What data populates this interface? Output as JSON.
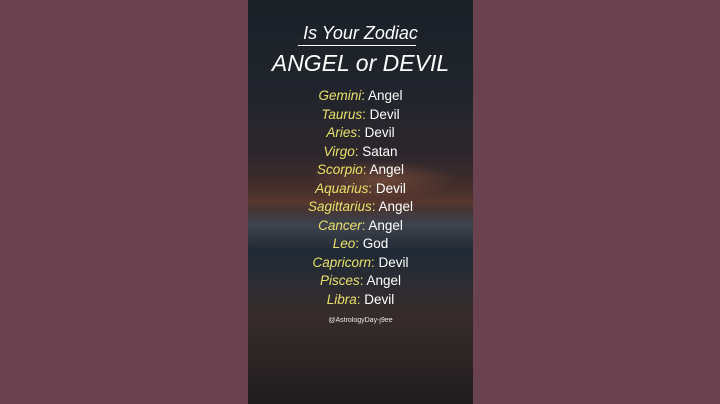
{
  "title_line_1": "Is Your Zodiac",
  "title_line_2": "ANGEL or DEVIL",
  "items": [
    {
      "sign": "Gemini",
      "verdict": "Angel"
    },
    {
      "sign": "Taurus",
      "verdict": "Devil"
    },
    {
      "sign": "Aries",
      "verdict": "Devil"
    },
    {
      "sign": "Virgo",
      "verdict": "Satan"
    },
    {
      "sign": "Scorpio",
      "verdict": "Angel"
    },
    {
      "sign": "Aquarius",
      "verdict": "Devil"
    },
    {
      "sign": "Sagittarius",
      "verdict": "Angel"
    },
    {
      "sign": "Cancer",
      "verdict": "Angel"
    },
    {
      "sign": "Leo",
      "verdict": "God"
    },
    {
      "sign": "Capricorn",
      "verdict": "Devil"
    },
    {
      "sign": "Pisces",
      "verdict": "Angel"
    },
    {
      "sign": "Libra",
      "verdict": "Devil"
    }
  ],
  "handle": "@AstrologyDay-j9ee",
  "colors": {
    "side_background": "#6b4250",
    "sign_text": "#e8e06a",
    "verdict_text": "#ffffff"
  }
}
